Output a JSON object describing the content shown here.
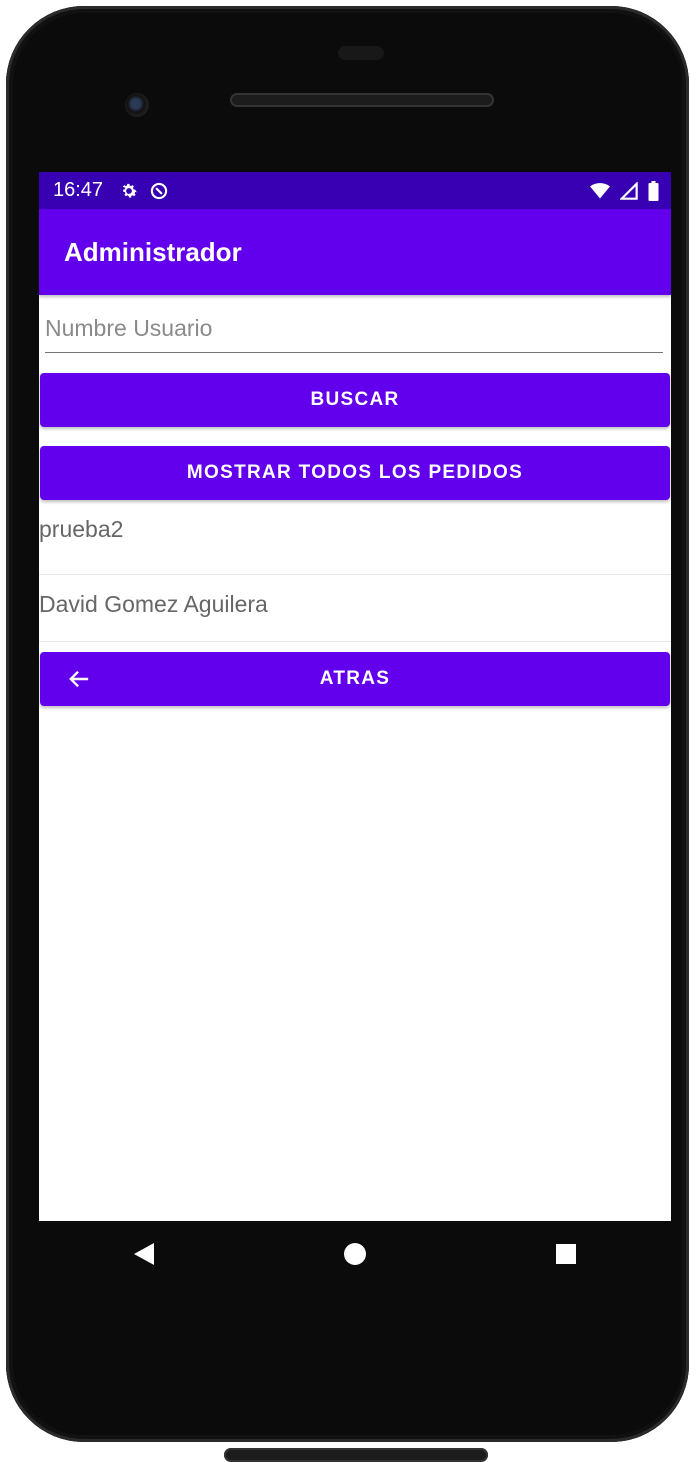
{
  "status_bar": {
    "time": "16:47",
    "left_icons": [
      "settings-icon",
      "data-saver-icon"
    ],
    "right_icons": [
      "wifi-icon",
      "cellular-signal-icon",
      "battery-icon"
    ]
  },
  "app_bar": {
    "title": "Administrador"
  },
  "search": {
    "placeholder": "Numbre Usuario",
    "value": ""
  },
  "buttons": {
    "search_label": "BUSCAR",
    "show_all_label": "MOSTRAR TODOS LOS PEDIDOS",
    "back_label": "ATRAS"
  },
  "users": [
    {
      "name": "prueba2"
    },
    {
      "name": "David Gomez Aguilera"
    }
  ],
  "nav_bar": {
    "icons": [
      "back-triangle-icon",
      "home-circle-icon",
      "recents-square-icon"
    ]
  },
  "colors": {
    "primary": "#6200ee",
    "primary_dark": "#3700b3",
    "on_primary": "#ffffff"
  }
}
